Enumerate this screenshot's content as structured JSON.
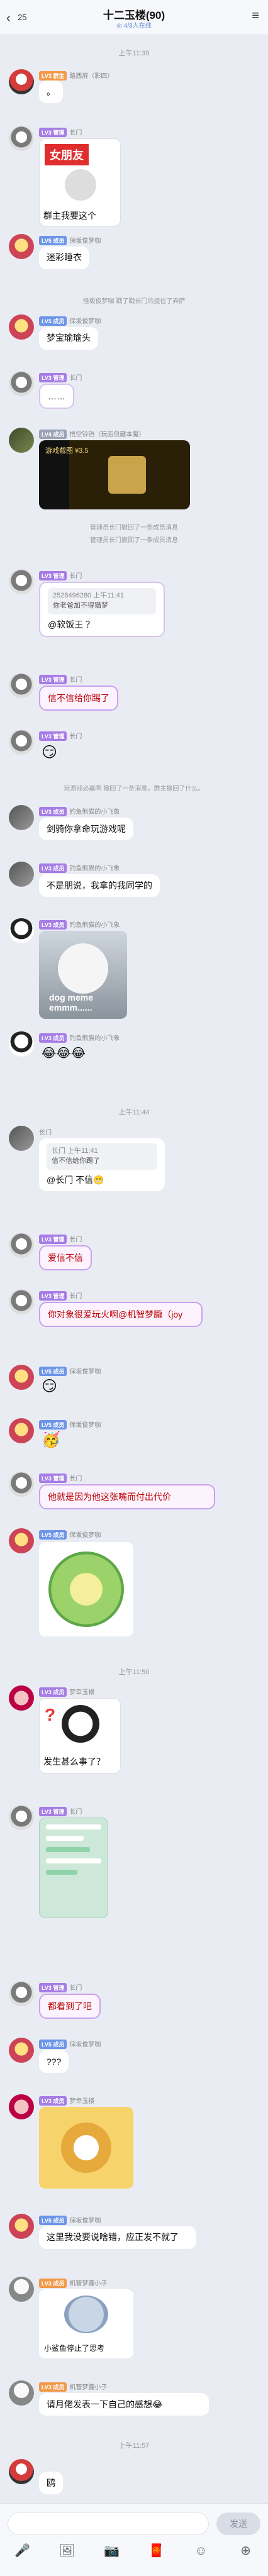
{
  "header": {
    "back_icon": "chevron-left",
    "unread": "25",
    "title": "十二玉楼(90)",
    "subtitle": "◎ 4/8人在线",
    "menu_icon": "hamburger"
  },
  "messages": [
    {
      "type": "time",
      "text": "上午11:39"
    },
    {
      "type": "text",
      "name": "群主",
      "name_extra": "路西屏（影四）",
      "bubble": "。",
      "avatar": "a"
    },
    {
      "type": "image",
      "name": "长门",
      "image": "女朋友 meme",
      "caption": "群主我要这个",
      "avatar": "b"
    },
    {
      "type": "text",
      "name": "保坂俊梦咖",
      "bubble": "迷彩睡衣",
      "avatar": "c",
      "hand": true
    },
    {
      "type": "sys",
      "text": "怪坂俊梦咖 戳了戳长门的捉住了弄萨"
    },
    {
      "type": "text",
      "name": "保坂俊梦咖",
      "bubble": "梦宝瑜瑜头",
      "avatar": "c",
      "hand": true
    },
    {
      "type": "text",
      "name": "长门",
      "bubble": "……",
      "avatar": "b",
      "deco": true
    },
    {
      "type": "image",
      "name": "悟空铃铛（玩面包藏本魔）",
      "image": "游戏截图 ¥3.5",
      "avatar": "d"
    },
    {
      "type": "sys",
      "text": "管理员长门撤回了一条成员消息"
    },
    {
      "type": "sys",
      "text": "管理员长门撤回了一条成员消息"
    },
    {
      "type": "reply",
      "name": "长门",
      "reply_head": "2528496280 上午11:41",
      "reply_text": "你老爸加不得猫梦",
      "bubble": "@软饭王 ？",
      "avatar": "b"
    },
    {
      "type": "text",
      "name": "长门",
      "bubble": "信不信给你踢了",
      "avatar": "b",
      "pink": true
    },
    {
      "type": "emoji",
      "name": "长门",
      "emoji": "😏",
      "avatar": "b"
    },
    {
      "type": "sys",
      "text": "玩游戏必赢啊 撤回了一条消息，群主撤回了什么。"
    },
    {
      "type": "text",
      "name": "钓鱼熊猫的小飞象",
      "bubble": "剑骑你拿命玩游戏呢",
      "avatar": "e"
    },
    {
      "type": "text",
      "name": "钓鱼熊猫的小飞象",
      "bubble": "不是朋说，我拿的我同学的",
      "avatar": "e"
    },
    {
      "type": "image",
      "name": "钓鱼熊猫的小飞象",
      "image": "dog meme emmm......",
      "avatar": "f"
    },
    {
      "type": "emojis",
      "name": "钓鱼熊猫的小飞象",
      "emoji": "😂😂😂",
      "avatar": "f"
    },
    {
      "type": "time",
      "text": "上午11:44"
    },
    {
      "type": "reply",
      "name": "长门",
      "reply_head": "长门 上午11:41",
      "reply_text": "信不信给你踢了",
      "bubble": "@长门 不信😬",
      "avatar": "e"
    },
    {
      "type": "text",
      "name": "长门",
      "bubble": "爱信不信",
      "avatar": "b",
      "pink": true
    },
    {
      "type": "text",
      "name": "长门",
      "bubble": "你对象很爱玩火啊@机智梦朧（joy",
      "avatar": "b",
      "pink": true
    },
    {
      "type": "emoji",
      "name": "保坂俊梦咖",
      "emoji": "😏",
      "avatar": "c"
    },
    {
      "type": "emoji",
      "name": "保坂俊梦咖",
      "emoji": "🥳",
      "avatar": "c"
    },
    {
      "type": "text",
      "name": "长门",
      "bubble": "他就是因为他这张嘴而付出代价",
      "avatar": "b",
      "pink": true
    },
    {
      "type": "image",
      "name": "保坂俊梦咖",
      "image": "cabbage sticker",
      "avatar": "c"
    },
    {
      "type": "time",
      "text": "上午11:50"
    },
    {
      "type": "image",
      "name": "梦幸玉楼",
      "image": "panda meme",
      "caption": "发生甚么事了？",
      "avatar": "g"
    },
    {
      "type": "image",
      "name": "长门",
      "image": "chat screenshot",
      "avatar": "b"
    },
    {
      "type": "text",
      "name": "长门",
      "bubble": "都看到了吧",
      "avatar": "b",
      "pink": true
    },
    {
      "type": "text",
      "name": "保坂俊梦咖",
      "bubble": "???",
      "avatar": "c"
    },
    {
      "type": "image",
      "name": "梦幸玉楼",
      "image": "doge sticker",
      "avatar": "g"
    },
    {
      "type": "text",
      "name": "保坂俊梦咖",
      "bubble": "这里我没要说啥错，应正发不就了",
      "avatar": "c",
      "hand": true
    },
    {
      "type": "image",
      "name": "机智梦朧小子",
      "image": "小鲨鱼停止了思考",
      "avatar": "h"
    },
    {
      "type": "text",
      "name": "机智梦朧小子",
      "bubble": "请月佬发表一下自己的感想😂",
      "avatar": "h"
    },
    {
      "type": "time",
      "text": "上午11:57"
    },
    {
      "type": "text",
      "name": "",
      "bubble": "鸥",
      "avatar": "a"
    }
  ],
  "composer": {
    "placeholder": "",
    "send_label": "发送",
    "tools": [
      "mic-icon",
      "image-icon",
      "camera-icon",
      "redpacket-icon",
      "emoji-icon",
      "plus-icon"
    ]
  }
}
